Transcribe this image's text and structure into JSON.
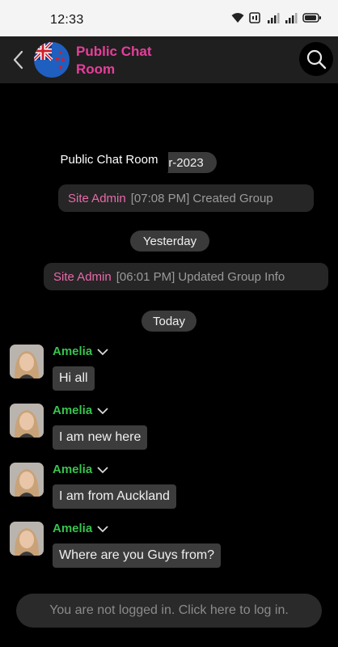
{
  "status_bar": {
    "time": "12:33",
    "icons": [
      "wifi-icon",
      "call-icon",
      "signal-icon",
      "signal-icon",
      "battery-icon"
    ]
  },
  "header": {
    "title": "Public Chat Room"
  },
  "tooltip": {
    "text": "Public Chat Room"
  },
  "date_separators": {
    "first": "r-2023",
    "yesterday": "Yesterday",
    "today": "Today"
  },
  "system_messages": [
    {
      "author": "Site Admin",
      "text": "[07:08 PM] Created Group"
    },
    {
      "author": "Site Admin",
      "text": "[06:01 PM] Updated Group Info"
    }
  ],
  "messages": [
    {
      "author": "Amelia",
      "text": "Hi all"
    },
    {
      "author": "Amelia",
      "text": "I am new here"
    },
    {
      "author": "Amelia",
      "text": "I am from Auckland"
    },
    {
      "author": "Amelia",
      "text": "Where are you Guys from?"
    }
  ],
  "login_prompt": "You are not logged in. Click here to log in.",
  "colors": {
    "title": "#e83e9b",
    "admin_name": "#e86aa9",
    "user_name": "#38c24e",
    "header_bg": "#1f1f1f",
    "chat_bg": "#000000"
  }
}
